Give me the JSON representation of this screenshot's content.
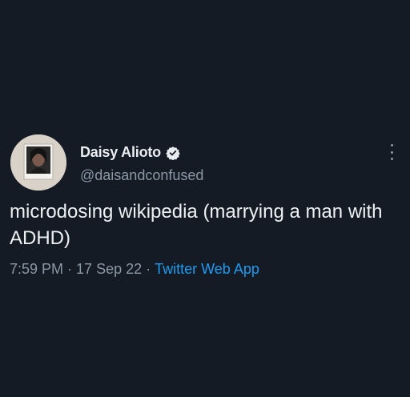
{
  "author": {
    "display_name": "Daisy Alioto",
    "handle": "@daisandconfused",
    "verified": true
  },
  "tweet": {
    "text": "microdosing wikipedia (marrying a man with ADHD)",
    "time": "7:59 PM",
    "separator": "·",
    "date": "17 Sep 22",
    "source": "Twitter Web App"
  },
  "icons": {
    "verified": "verified-badge-icon",
    "more": "more-options-icon"
  },
  "colors": {
    "background": "#141b24",
    "primary_text": "#eef1f3",
    "secondary_text": "#8b98a5",
    "link": "#1d9bf0"
  }
}
